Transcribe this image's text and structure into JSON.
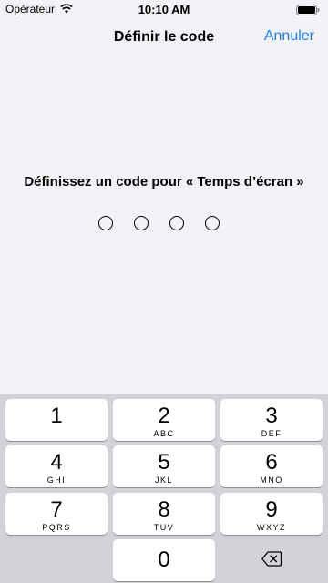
{
  "status_bar": {
    "carrier": "Opérateur",
    "time": "10:10 AM"
  },
  "nav": {
    "title": "Définir le code",
    "cancel_label": "Annuler"
  },
  "prompt": "Définissez un code pour « Temps d’écran »",
  "passcode": {
    "length": 4,
    "entered": 0
  },
  "keypad": {
    "keys": [
      {
        "digit": "1",
        "letters": ""
      },
      {
        "digit": "2",
        "letters": "ABC"
      },
      {
        "digit": "3",
        "letters": "DEF"
      },
      {
        "digit": "4",
        "letters": "GHI"
      },
      {
        "digit": "5",
        "letters": "JKL"
      },
      {
        "digit": "6",
        "letters": "MNO"
      },
      {
        "digit": "7",
        "letters": "PQRS"
      },
      {
        "digit": "8",
        "letters": "TUV"
      },
      {
        "digit": "9",
        "letters": "WXYZ"
      },
      {
        "digit": "0",
        "letters": ""
      }
    ],
    "delete_icon": "backspace-icon"
  },
  "colors": {
    "accent": "#1a7ef5",
    "background": "#f2f2f7",
    "keypad_background": "#d1d3d9"
  }
}
